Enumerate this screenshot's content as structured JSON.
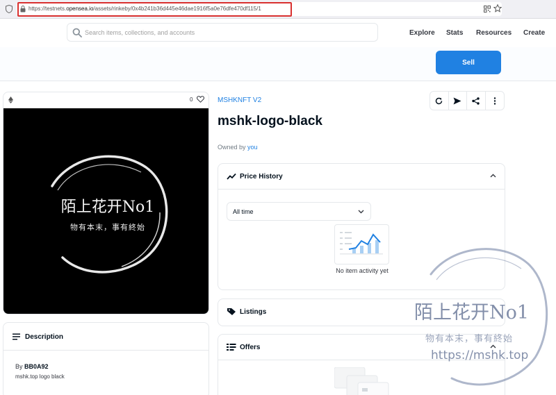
{
  "browser": {
    "url_prefix": "https://testnets.",
    "url_domain": "opensea.io",
    "url_path": "/assets/rinkeby/0x4b241b36d445e46dae1916f5a0e76dfe470df115/1"
  },
  "header": {
    "search_placeholder": "Search items, collections, and accounts",
    "nav": [
      "Explore",
      "Stats",
      "Resources",
      "Create"
    ]
  },
  "sell_label": "Sell",
  "item": {
    "favorites": "0",
    "art_title": "陌上花开No1",
    "art_subtitle": "物有本末，事有終始",
    "collection": "MSHKNFT V2",
    "name": "mshk-logo-black",
    "owned_by_label": "Owned by",
    "owner": "you"
  },
  "description": {
    "title": "Description",
    "by_label": "By",
    "creator": "BB0A92",
    "text": "mshk.top logo black"
  },
  "price_history": {
    "title": "Price History",
    "range": "All time",
    "empty_text": "No item activity yet"
  },
  "listings": {
    "title": "Listings"
  },
  "offers": {
    "title": "Offers"
  },
  "watermark": {
    "line1": "陌上花开No1",
    "line2": "物有本末，事有終始",
    "line3": "https://mshk.top"
  },
  "colors": {
    "accent": "#2081e2",
    "url_highlight": "#d9302f",
    "chart_line": "#2081e2"
  }
}
